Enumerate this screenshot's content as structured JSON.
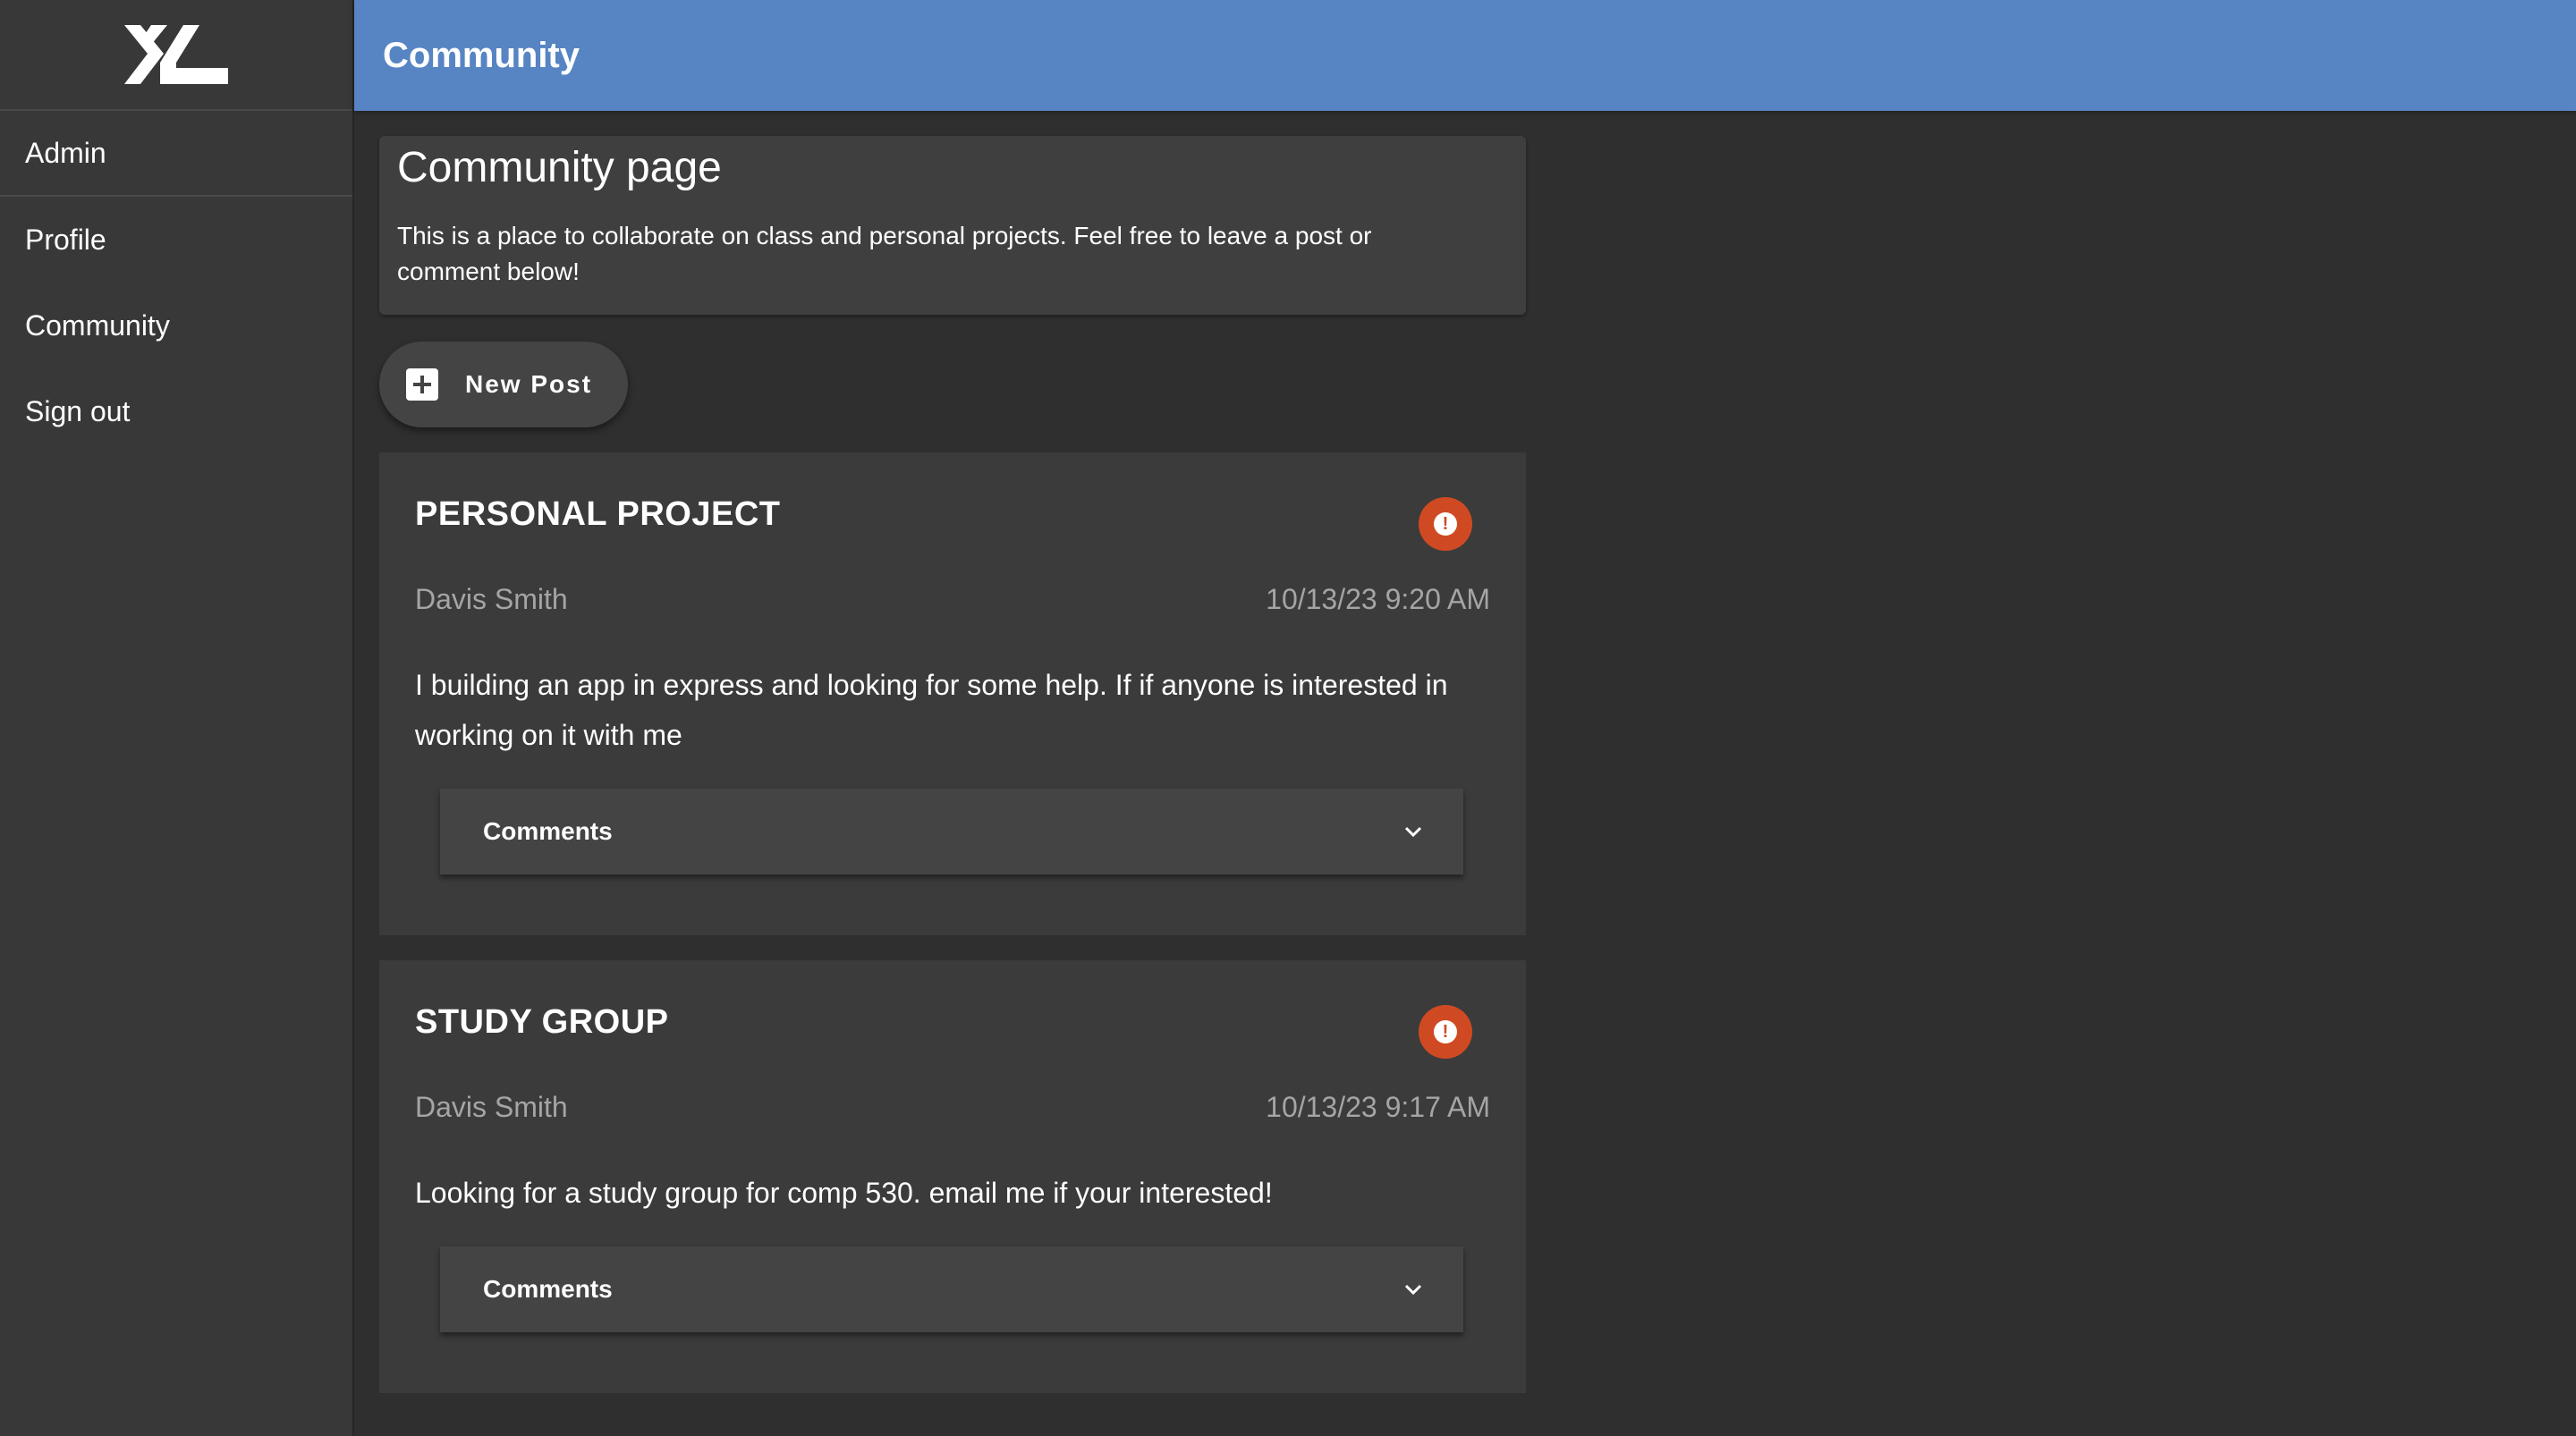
{
  "app": {
    "logo_text": "XL",
    "header_title": "Community"
  },
  "sidebar": {
    "items": [
      {
        "label": "Admin"
      },
      {
        "label": "Profile"
      },
      {
        "label": "Community"
      },
      {
        "label": "Sign out"
      }
    ]
  },
  "intro": {
    "title": "Community page",
    "text": "This is a place to collaborate on class and personal projects. Feel free to leave a post or comment below!"
  },
  "new_post": {
    "label": "New Post",
    "icon": "plus-box-icon"
  },
  "posts": [
    {
      "title": "PERSONAL PROJECT",
      "author": "Davis Smith",
      "timestamp": "10/13/23 9:20 AM",
      "body": "I building an app in express and looking for some help. If if anyone is interested in working on it with me",
      "comments_label": "Comments"
    },
    {
      "title": "STUDY GROUP",
      "author": "Davis Smith",
      "timestamp": "10/13/23 9:17 AM",
      "body": "Looking for a study group for comp 530. email me if your interested!",
      "comments_label": "Comments"
    }
  ],
  "colors": {
    "header": "#5784c3",
    "alert": "#cf4a22",
    "background": "#2f2f2f",
    "sidebar": "#383838"
  }
}
